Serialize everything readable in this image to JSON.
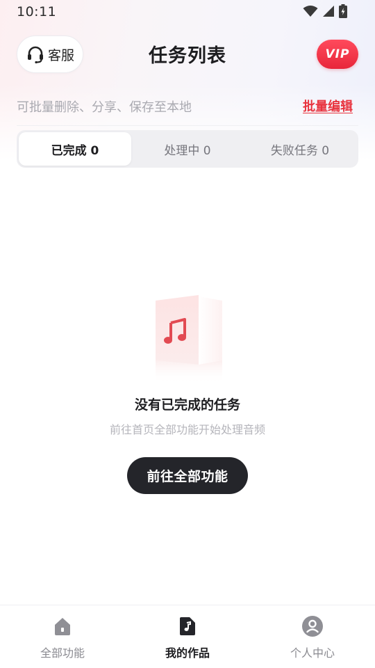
{
  "status_bar": {
    "time": "10:11",
    "icons": [
      "wifi-icon",
      "cellular-signal-icon",
      "battery-charging-icon"
    ]
  },
  "header": {
    "service_label": "客服",
    "service_icon": "headset-icon",
    "title": "任务列表",
    "vip_label": "VIP"
  },
  "hint": {
    "text": "可批量删除、分享、保存至本地",
    "action": "批量编辑"
  },
  "tabs": [
    {
      "label": "已完成 0",
      "active": true
    },
    {
      "label": "处理中 0",
      "active": false
    },
    {
      "label": "失败任务 0",
      "active": false
    }
  ],
  "empty_state": {
    "icon": "music-note-icon",
    "title": "没有已完成的任务",
    "subtitle": "前往首页全部功能开始处理音频",
    "button": "前往全部功能"
  },
  "bottom_nav": [
    {
      "label": "全部功能",
      "icon": "home-icon",
      "active": false
    },
    {
      "label": "我的作品",
      "icon": "music-file-icon",
      "active": true
    },
    {
      "label": "个人中心",
      "icon": "user-icon",
      "active": false
    }
  ],
  "colors": {
    "accent": "#e8343f",
    "vip_gradient_top": "#ff4a5c",
    "vip_gradient_bottom": "#e8263a",
    "button_dark": "#24252a",
    "tab_background": "#efeff2"
  }
}
